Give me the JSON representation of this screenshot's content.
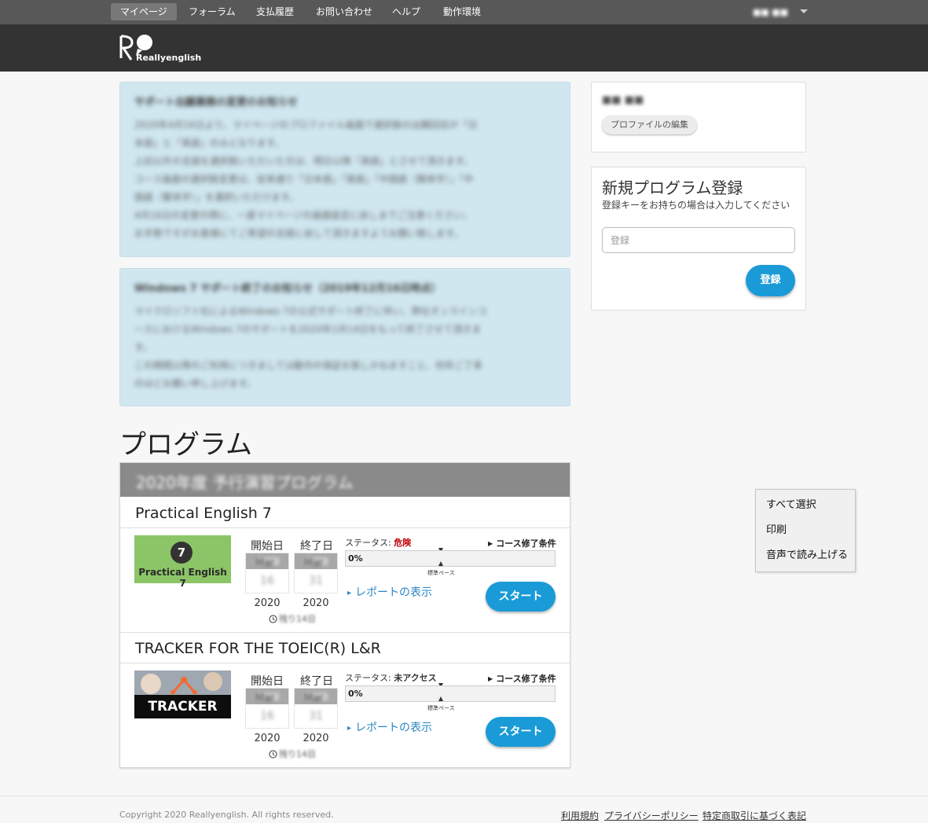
{
  "nav": {
    "items": [
      {
        "label": "マイページ",
        "active": true
      },
      {
        "label": "フォーラム",
        "active": false
      },
      {
        "label": "支払履歴",
        "active": false
      },
      {
        "label": "お問い合わせ",
        "active": false
      },
      {
        "label": "ヘルプ",
        "active": false
      },
      {
        "label": "動作環境",
        "active": false
      }
    ],
    "user_name": "■■ ■■"
  },
  "brand": {
    "wordmark": "Reallyenglish"
  },
  "notices": [
    {
      "title": "サポート出願業務の変更のお知らせ",
      "lines": [
        "2020年4月16日より、マイページのプロファイル画面で選択肢の出願回収が「日",
        "本語」と「英語」のみとなります。",
        "上記以外の言語を選択肢いただいた方は、明日以降「英語」とさせて頂きます。",
        "コース画面の選択肢変更は、従来通り「日本語」「英語」「中国語（簡体字）」「中",
        "国語（繁体字）」を選択いただけます。",
        "4月16日の変更の際に、一度マイページの画面設定に戻しまでご注意ください。",
        "お手数ですがお客様にてご希望の言語に戻して頂きますようお願い致します。"
      ]
    },
    {
      "title": "Windows 7 サポート終了のお知らせ（2019年12月16日時点）",
      "lines": [
        "マイクロソフト社によるWindows 7の公式サポート終了に伴い、弊社オンラインコ",
        "ースにおけるWindows 7のサポートを2020年1月14日をもって終了させて頂きま",
        "す。",
        "この期間以降のご利用につきましては動作の保証を致しかねますこと、何卒ご了承",
        "のほどお願い申し上げます。"
      ]
    }
  ],
  "profile": {
    "name": "■■ ■■",
    "edit_label": "プロファイルの編集"
  },
  "register": {
    "title": "新規プログラム登録",
    "description": "登録キーをお持ちの場合は入力してください",
    "placeholder": "登録",
    "button_label": "登録"
  },
  "programs": {
    "section_title": "プログラム",
    "group_title": "2020年度 予行演習プログラム",
    "courses": [
      {
        "title": "Practical English 7",
        "thumbnail": {
          "badge": "7",
          "label": "Practical English 7",
          "icon": "practical-english-logo"
        },
        "start_label": "開始日",
        "end_label": "終了日",
        "start_month": "Mar",
        "start_day": "16",
        "start_year": "2020",
        "end_month": "Mar",
        "end_day": "31",
        "end_year": "2020",
        "remaining": "残り14日",
        "status_label": "ステータス:",
        "status_value": "危険",
        "condition_label": "コース修了条件",
        "progress": 0,
        "progress_text": "0%",
        "pace_label": "標準ペース",
        "report_label": "レポートの表示",
        "start_button": "スタート"
      },
      {
        "title": "TRACKER FOR THE TOEIC(R) L&R",
        "thumbnail": {
          "label": "TRACKER",
          "icon": "tracker-logo"
        },
        "start_label": "開始日",
        "end_label": "終了日",
        "start_month": "Mar",
        "start_day": "16",
        "start_year": "2020",
        "end_month": "Mar",
        "end_day": "31",
        "end_year": "2020",
        "remaining": "残り14日",
        "status_label": "ステータス:",
        "status_value": "未アクセス",
        "condition_label": "コース修了条件",
        "progress": 0,
        "progress_text": "0%",
        "pace_label": "標準ペース",
        "report_label": "レポートの表示",
        "start_button": "スタート"
      }
    ]
  },
  "context_menu": {
    "items": [
      "すべて選択",
      "印刷",
      "音声で読み上げる"
    ]
  },
  "footer": {
    "copyright": "Copyright 2020 Reallyenglish. All rights reserved.",
    "links": [
      "利用規約",
      "プライバシーポリシー",
      "特定商取引に基づく表記"
    ]
  },
  "colors": {
    "accent": "#1a9bd7",
    "header_bg": "#333333",
    "nav_bg": "#585858",
    "notice_bg": "#d0e7f0",
    "danger": "#c00000"
  }
}
